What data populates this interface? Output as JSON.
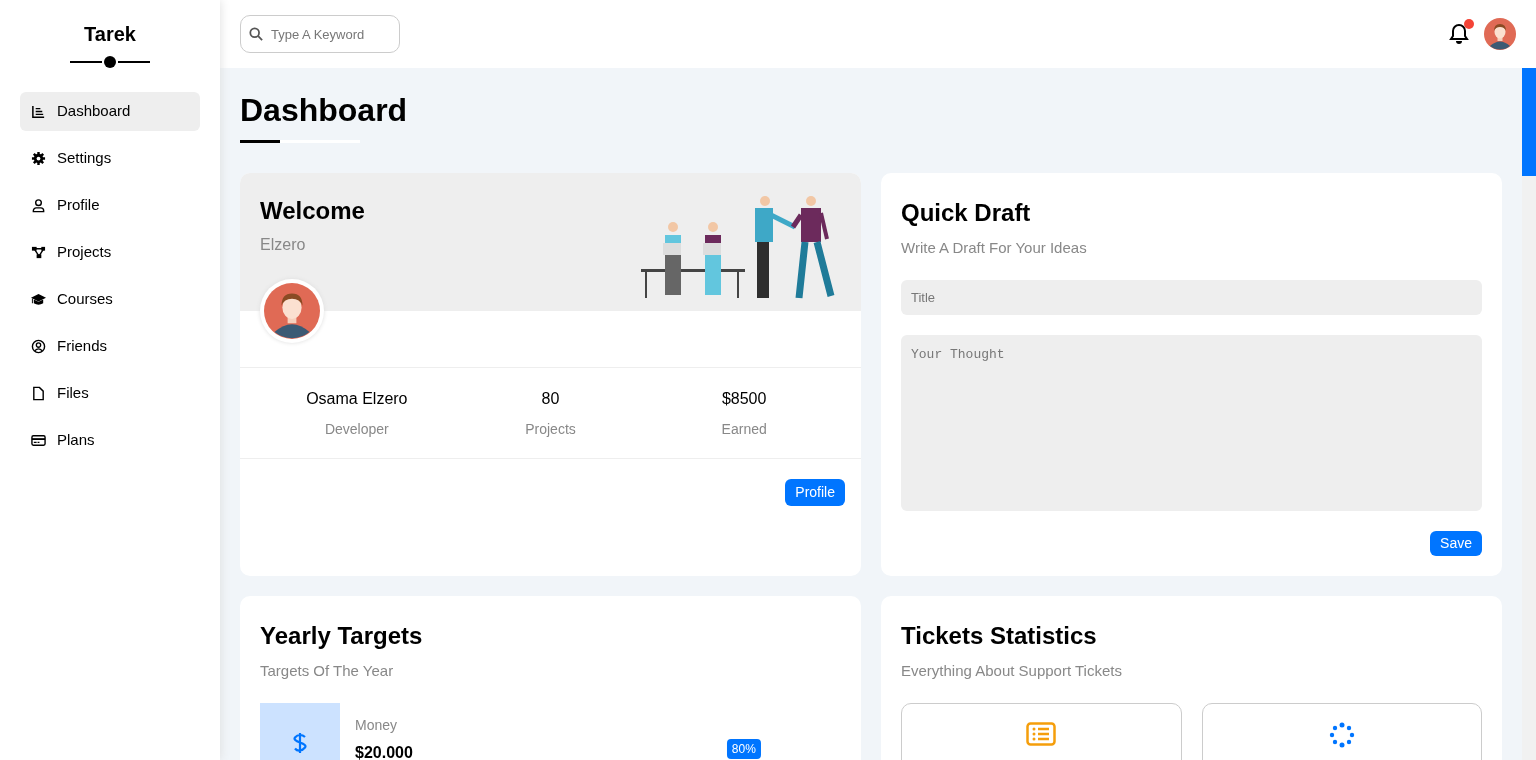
{
  "sidebar": {
    "brand": "Tarek",
    "items": [
      {
        "label": "Dashboard",
        "selected": true
      },
      {
        "label": "Settings",
        "selected": false
      },
      {
        "label": "Profile",
        "selected": false
      },
      {
        "label": "Projects",
        "selected": false
      },
      {
        "label": "Courses",
        "selected": false
      },
      {
        "label": "Friends",
        "selected": false
      },
      {
        "label": "Files",
        "selected": false
      },
      {
        "label": "Plans",
        "selected": false
      }
    ]
  },
  "header": {
    "search": {
      "placeholder": "Type A Keyword"
    },
    "notifications": {
      "unread": true
    }
  },
  "page_title": "Dashboard",
  "welcome": {
    "title": "Welcome",
    "subtitle": "Elzero",
    "stats": [
      {
        "value": "Osama Elzero",
        "label": "Developer"
      },
      {
        "value": "80",
        "label": "Projects"
      },
      {
        "value": "$8500",
        "label": "Earned"
      }
    ],
    "button": "Profile"
  },
  "quick_draft": {
    "title": "Quick Draft",
    "subtitle": "Write A Draft For Your Ideas",
    "title_field": {
      "placeholder": "Title"
    },
    "thought_field": {
      "placeholder": "Your Thought"
    },
    "button": "Save"
  },
  "yearly_targets": {
    "title": "Yearly Targets",
    "subtitle": "Targets Of The Year",
    "targets": [
      {
        "label": "Money",
        "value": "$20.000",
        "progress": "80%",
        "level": 0.8
      }
    ]
  },
  "tickets": {
    "title": "Tickets Statistics",
    "subtitle": "Everything About Support Tickets",
    "boxes": [
      {
        "kind": "list"
      },
      {
        "kind": "spinner"
      }
    ]
  }
}
